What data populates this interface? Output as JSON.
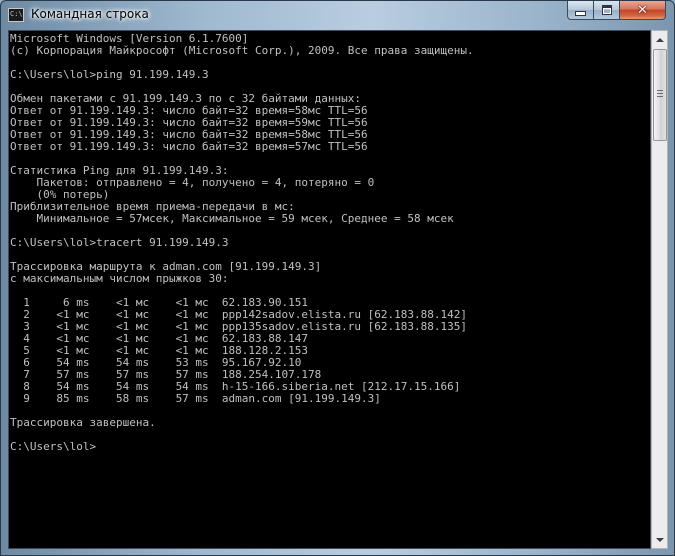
{
  "window": {
    "title": "Командная строка",
    "icon": "cmd-icon",
    "icon_text": "C:\\"
  },
  "controls": {
    "minimize": "minimize-icon",
    "maximize": "maximize-icon",
    "close": "close-icon",
    "close_glyph": "✕"
  },
  "console": {
    "lines": [
      "Microsoft Windows [Version 6.1.7600]",
      "(c) Корпорация Майкрософт (Microsoft Corp.), 2009. Все права защищены.",
      "",
      "C:\\Users\\lol>ping 91.199.149.3",
      "",
      "Обмен пакетами с 91.199.149.3 по с 32 байтами данных:",
      "Ответ от 91.199.149.3: число байт=32 время=58мс TTL=56",
      "Ответ от 91.199.149.3: число байт=32 время=59мс TTL=56",
      "Ответ от 91.199.149.3: число байт=32 время=58мс TTL=56",
      "Ответ от 91.199.149.3: число байт=32 время=57мс TTL=56",
      "",
      "Статистика Ping для 91.199.149.3:",
      "    Пакетов: отправлено = 4, получено = 4, потеряно = 0",
      "    (0% потерь)",
      "Приблизительное время приема-передачи в мс:",
      "    Минимальное = 57мсек, Максимальное = 59 мсек, Среднее = 58 мсек",
      "",
      "C:\\Users\\lol>tracert 91.199.149.3",
      "",
      "Трассировка маршрута к adman.com [91.199.149.3]",
      "с максимальным числом прыжков 30:",
      "",
      "  1     6 ms    <1 мс    <1 мс  62.183.90.151",
      "  2    <1 мс    <1 мс    <1 мс  ppp142sadov.elista.ru [62.183.88.142]",
      "  3    <1 мс    <1 мс    <1 мс  ppp135sadov.elista.ru [62.183.88.135]",
      "  4    <1 мс    <1 мс    <1 мс  62.183.88.147",
      "  5    <1 мс    <1 мс    <1 мс  188.128.2.153",
      "  6    54 ms    54 ms    53 ms  95.167.92.10",
      "  7    57 ms    57 ms    57 ms  188.254.107.178",
      "  8    54 ms    54 ms    54 ms  h-15-166.siberia.net [212.17.15.166]",
      "  9    85 ms    58 ms    57 ms  adman.com [91.199.149.3]",
      "",
      "Трассировка завершена.",
      "",
      "C:\\Users\\lol>"
    ]
  },
  "scrollbar": {
    "up": "scroll-up-arrow-icon",
    "down": "scroll-down-arrow-icon"
  }
}
